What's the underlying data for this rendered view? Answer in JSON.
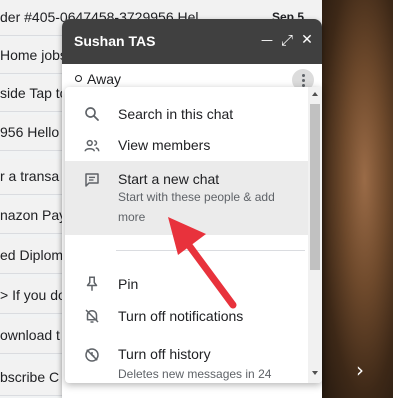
{
  "email_list": {
    "rows": [
      {
        "text": "der #405-0647458-3729956 Hel",
        "date": "Sep 5"
      },
      {
        "text": "Home jobs",
        "date": ""
      },
      {
        "text": "side Tap to",
        "date": ""
      },
      {
        "text": "956 Hello",
        "date": ""
      },
      {
        "text": "r a transa",
        "date": ""
      },
      {
        "text": "nazon Pay",
        "date": ""
      },
      {
        "text": "ed Diplom",
        "date": ""
      },
      {
        "text": "> If you do",
        "date": ""
      },
      {
        "text": "ownload t",
        "date": ""
      },
      {
        "text": "bscribe C",
        "date": ""
      }
    ]
  },
  "side_panel": {
    "chevron_icon": "chevron-right-icon",
    "chevron_glyph": "›"
  },
  "chat": {
    "title": "Sushan TAS",
    "header_buttons": {
      "minimize_glyph": "—",
      "popout_glyph": "⤢",
      "close_glyph": "✕"
    },
    "status": "Away"
  },
  "menu": {
    "items": [
      {
        "label": "Search in this chat",
        "icon": "search-icon"
      },
      {
        "label": "View members",
        "icon": "people-icon"
      },
      {
        "label": "Start a new chat",
        "sub": "Start with these people & add more",
        "icon": "chat-bubble-icon"
      },
      {
        "label": "Pin",
        "icon": "pin-icon"
      },
      {
        "label": "Turn off notifications",
        "icon": "bell-off-icon"
      },
      {
        "label": "Turn off history",
        "sub": "Deletes new messages in 24",
        "icon": "history-off-icon"
      }
    ]
  },
  "colors": {
    "header_bg": "#404040",
    "highlight_bg": "#ebebeb",
    "arrow_red": "#e8323c"
  }
}
